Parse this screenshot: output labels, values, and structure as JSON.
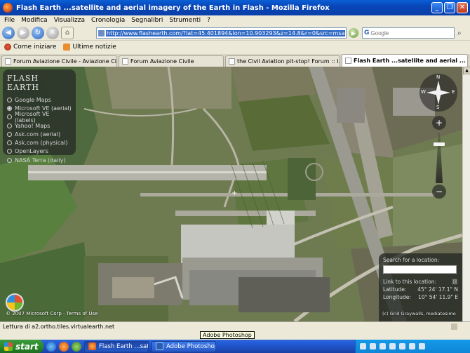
{
  "window": {
    "title": "Flash Earth ...satellite and aerial imagery of the Earth in Flash - Mozilla Firefox"
  },
  "menu": [
    "File",
    "Modifica",
    "Visualizza",
    "Cronologia",
    "Segnalibri",
    "Strumenti",
    "?"
  ],
  "nav": {
    "url": "http://www.flashearth.com/?lat=45.401894&lon=10.903293&z=14.8&r=0&src=msa",
    "search_placeholder": "Google",
    "search_engine": "G"
  },
  "bookmarks": [
    "Come iniziare",
    "Ultime notizie"
  ],
  "tabs": [
    {
      "label": "Forum Aviazione Civile - Aviazione Civile",
      "active": false
    },
    {
      "label": "Forum Aviazione Civile",
      "active": false
    },
    {
      "label": "the Civil Aviation pit-stop! Forum :: I...",
      "active": false
    },
    {
      "label": "Flash Earth ...satellite and aerial ...",
      "active": true
    }
  ],
  "flash_earth": {
    "title": "FLASH EARTH",
    "sources": [
      {
        "label": "Google Maps",
        "selected": false
      },
      {
        "label": "Microsoft VE (aerial)",
        "selected": true
      },
      {
        "label": "Microsoft VE (labels)",
        "selected": false
      },
      {
        "label": "Yahoo! Maps",
        "selected": false
      },
      {
        "label": "Ask.com (aerial)",
        "selected": false
      },
      {
        "label": "Ask.com (physical)",
        "selected": false
      },
      {
        "label": "OpenLayers",
        "selected": false
      },
      {
        "label": "NASA Terra (daily)",
        "selected": false
      }
    ],
    "compass": {
      "n": "N",
      "s": "S",
      "e": "E",
      "w": "W"
    },
    "zoom_in": "+",
    "zoom_out": "−",
    "location": {
      "search_label": "Search for a location:",
      "link_label": "Link to this location:",
      "latitude_label": "Latitude:",
      "latitude_value": "45° 24' 17.1\" N",
      "longitude_label": "Longitude:",
      "longitude_value": "10° 54' 11.9\" E"
    },
    "copyright_left": "© 2007 Microsoft Corp · Terms of Use",
    "copyright_right": "(c) Grid Graywalls, mediatesimo"
  },
  "status": {
    "text": "Lettura di a2.ortho.tiles.virtualearth.net"
  },
  "tooltip": "Adobe Photoshop",
  "taskbar": {
    "start": "start",
    "items": [
      {
        "label": "Flash Earth ...satellit...",
        "pressed": true
      },
      {
        "label": "Adobe Photoshop",
        "pressed": false
      }
    ]
  }
}
